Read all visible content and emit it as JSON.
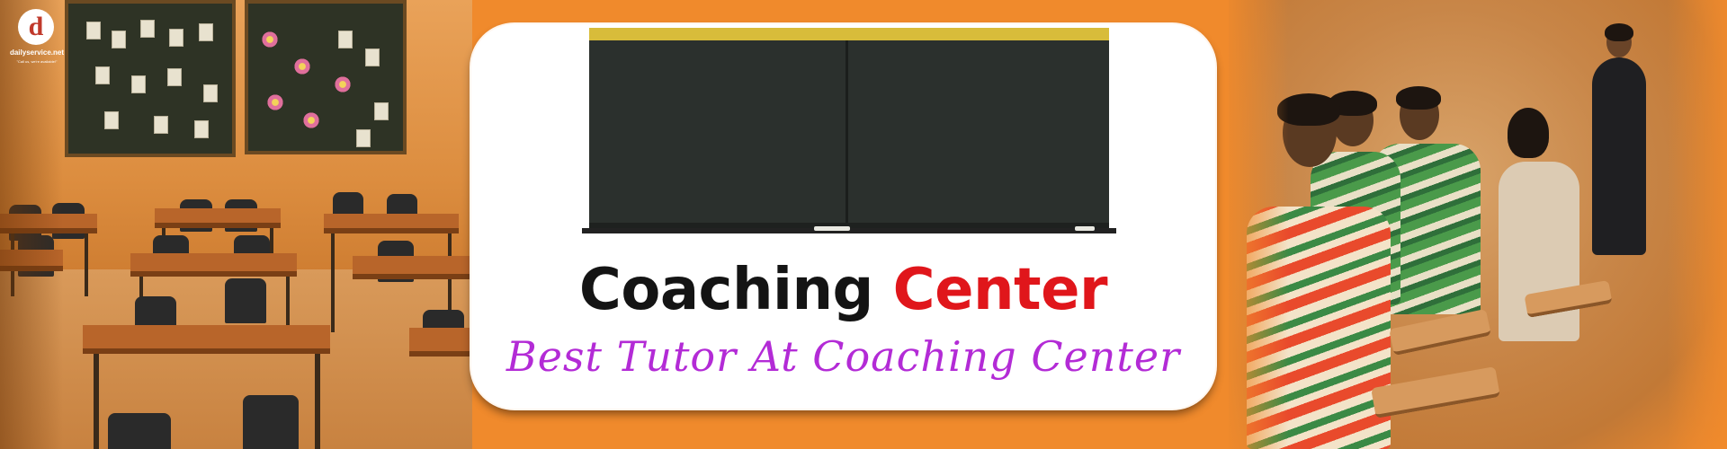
{
  "logo": {
    "letter": "d",
    "name": "dailyservice.net",
    "slogan": "\"Call us, we're available!\""
  },
  "banner": {
    "headline_word_1": "Coaching",
    "headline_word_2": "Center",
    "tagline": "Best Tutor At Coaching Center"
  },
  "colors": {
    "background": "#f08a2c",
    "headline_dark": "#141414",
    "headline_red": "#e0161b",
    "tagline_purple": "#b32bd6",
    "card": "#ffffff"
  },
  "images": {
    "left": "classroom-with-desks-and-bulletin-boards",
    "center": "blackboard",
    "right": "tutor-teaching-students"
  }
}
